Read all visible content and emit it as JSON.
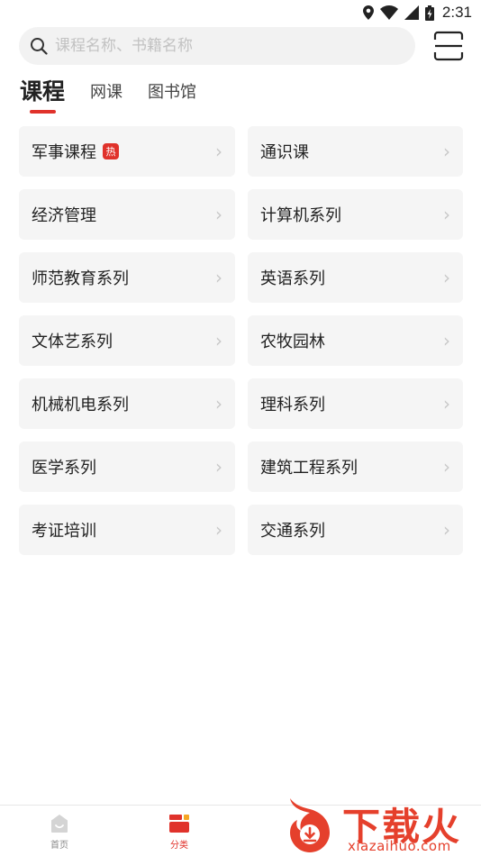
{
  "status_bar": {
    "time": "2:31"
  },
  "search": {
    "placeholder": "课程名称、书籍名称"
  },
  "tabs": [
    {
      "label": "课程",
      "active": true
    },
    {
      "label": "网课",
      "active": false
    },
    {
      "label": "图书馆",
      "active": false
    }
  ],
  "categories": [
    {
      "label": "军事课程",
      "badge": "热"
    },
    {
      "label": "通识课"
    },
    {
      "label": "经济管理"
    },
    {
      "label": "计算机系列"
    },
    {
      "label": "师范教育系列"
    },
    {
      "label": "英语系列"
    },
    {
      "label": "文体艺系列"
    },
    {
      "label": "农牧园林"
    },
    {
      "label": "机械机电系列"
    },
    {
      "label": "理科系列"
    },
    {
      "label": "医学系列"
    },
    {
      "label": "建筑工程系列"
    },
    {
      "label": "考证培训"
    },
    {
      "label": "交通系列"
    }
  ],
  "bottom_nav": {
    "home_label": "首页",
    "category_label": "分类"
  },
  "watermark": {
    "text": "下载火",
    "url": "xiazaihuo.com"
  },
  "colors": {
    "accent": "#e0322b",
    "cell_bg": "#f5f5f5",
    "search_bg": "#f2f2f2"
  }
}
